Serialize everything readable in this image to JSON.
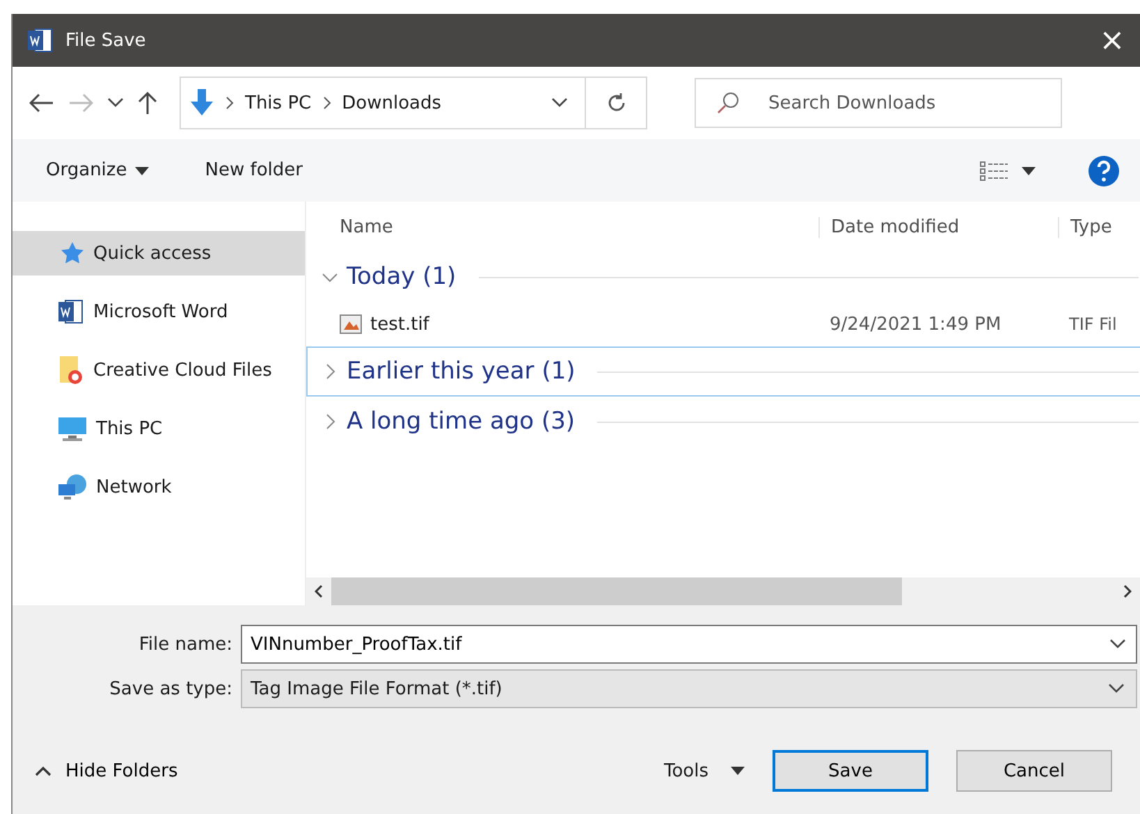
{
  "window": {
    "title": "File Save",
    "close": "×"
  },
  "address": {
    "crumbs": [
      "This PC",
      "Downloads"
    ]
  },
  "search": {
    "placeholder": "Search Downloads"
  },
  "toolbar": {
    "organize": "Organize",
    "new_folder": "New folder"
  },
  "sidebar": {
    "items": [
      {
        "label": "Quick access",
        "selected": true
      },
      {
        "label": "Microsoft Word",
        "selected": false
      },
      {
        "label": "Creative Cloud Files",
        "selected": false
      },
      {
        "label": "This PC",
        "selected": false
      },
      {
        "label": "Network",
        "selected": false
      }
    ]
  },
  "table": {
    "columns": [
      "Name",
      "Date modified",
      "Type"
    ],
    "groups": [
      {
        "label": "Today (1)",
        "expanded": true,
        "selected": false,
        "rows": [
          {
            "name": "test.tif",
            "date": "9/24/2021 1:49 PM",
            "type": "TIF Fil"
          }
        ]
      },
      {
        "label": "Earlier this year (1)",
        "expanded": false,
        "selected": true
      },
      {
        "label": "A long time ago (3)",
        "expanded": false,
        "selected": false
      }
    ]
  },
  "form": {
    "file_name_label": "File name:",
    "file_name": "VINnumber_ProofTax.tif",
    "type_label": "Save as type:",
    "type": "Tag Image File Format (*.tif)"
  },
  "footer": {
    "hide_folders": "Hide Folders",
    "tools": "Tools",
    "save": "Save",
    "cancel": "Cancel"
  }
}
